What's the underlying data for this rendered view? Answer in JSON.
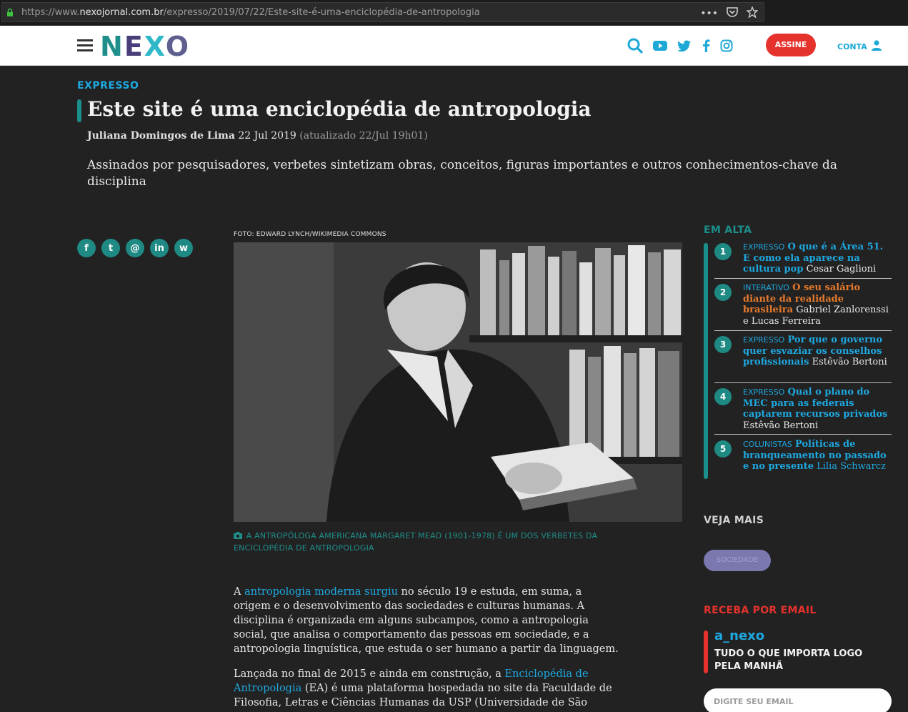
{
  "browser": {
    "url_prefix": "https://www.",
    "url_domain": "nexojornal.com.br",
    "url_path": "/expresso/2019/07/22/Este-site-é-uma-enciclopédia-de-antropologia",
    "more_label": "•••"
  },
  "header": {
    "logo": [
      "N",
      "E",
      "X",
      "O"
    ],
    "assine_label": "ASSINE",
    "conta_label": "CONTA"
  },
  "article": {
    "section": "EXPRESSO",
    "title": "Este site é uma enciclopédia de antropologia",
    "author": "Juliana Domingos de Lima",
    "date": "22 Jul 2019",
    "updated": "(atualizado 22/Jul 19h01)",
    "lead": "Assinados por pesquisadores, verbetes sintetizam obras, conceitos, figuras importantes e outros conhecimentos-chave da disciplina",
    "share": [
      "f",
      "t",
      "@",
      "in",
      "w"
    ],
    "photo_credit": "FOTO: EDWARD LYNCH/WIKIMEDIA COMMONS",
    "caption": "A ANTROPÓLOGA AMERICANA MARGARET MEAD (1901-1978) É UM DOS VERBETES DA ENCICLOPÉDIA DE ANTROPOLOGIA",
    "p1_before": "A ",
    "p1_link": "antropologia moderna surgiu",
    "p1_after": " no século 19 e estuda, em suma, a origem e o desenvolvimento das sociedades e culturas humanas. A disciplina é organizada em alguns subcampos, como a antropologia social, que analisa o comportamento das pessoas em sociedade, e a antropologia linguística, que estuda o ser humano a partir da linguagem.",
    "p2_before": "Lançada no final de 2015 e ainda em construção, a ",
    "p2_link": "Enciclopédia de Antropologia",
    "p2_after": " (EA) é uma plataforma hospedada no site da Faculdade de Filosofia, Letras e Ciências Humanas da USP (Universidade de São"
  },
  "sidebar": {
    "em_alta_title": "EM ALTA",
    "items": [
      {
        "num": "1",
        "category": "EXPRESSO",
        "headline": "O que é a Área 51. E como ela aparece na cultura pop",
        "author": "Cesar Gaglioni"
      },
      {
        "num": "2",
        "category": "INTERATIVO",
        "headline": "O seu salário diante da realidade brasileira",
        "author": "Gabriel Zanlorenssi e Lucas Ferreira"
      },
      {
        "num": "3",
        "category": "EXPRESSO",
        "headline": "Por que o governo quer esvaziar os conselhos profissionais",
        "author": "Estêvão Bertoni"
      },
      {
        "num": "4",
        "category": "EXPRESSO",
        "headline": "Qual o plano do MEC para as federais captarem recursos privados",
        "author": "Estêvão Bertoni"
      },
      {
        "num": "5",
        "category": "COLUNISTAS",
        "headline": "Políticas de branqueamento no passado e no presente",
        "author": "Lilia Schwarcz"
      }
    ],
    "veja_mais_title": "VEJA MAIS",
    "tag_pill": "SOCIEDADE",
    "receba_title": "RECEBA POR EMAIL",
    "anexo_logo": "a_nexo",
    "anexo_tagline": "TUDO O QUE IMPORTA LOGO PELA MANHÃ",
    "email_placeholder": "DIGITE SEU EMAIL"
  },
  "colors": {
    "accent_teal": "#1b8f8b",
    "link_blue": "#1ea8e0",
    "red": "#e5322c",
    "orange": "#e57a2c"
  }
}
